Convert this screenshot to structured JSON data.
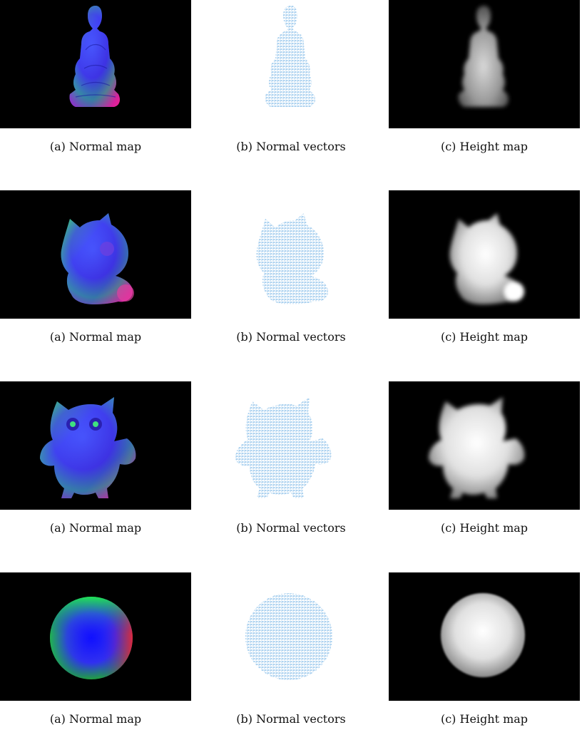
{
  "figures": [
    {
      "object": "buddha",
      "captions": [
        "(a) Normal map",
        "(b) Normal vectors",
        "(c) Height map"
      ]
    },
    {
      "object": "cat",
      "captions": [
        "(a) Normal map",
        "(b) Normal vectors",
        "(c) Height map"
      ]
    },
    {
      "object": "owl",
      "captions": [
        "(a) Normal map",
        "(b) Normal vectors",
        "(c) Height map"
      ]
    },
    {
      "object": "sphere",
      "captions": [
        "(a) Normal map",
        "(b) Normal vectors",
        "(c) Height map"
      ]
    }
  ],
  "colors": {
    "background_dark": "#000000",
    "vector_blue": "#5aa6e0",
    "height_light": "#f2f2f2"
  }
}
